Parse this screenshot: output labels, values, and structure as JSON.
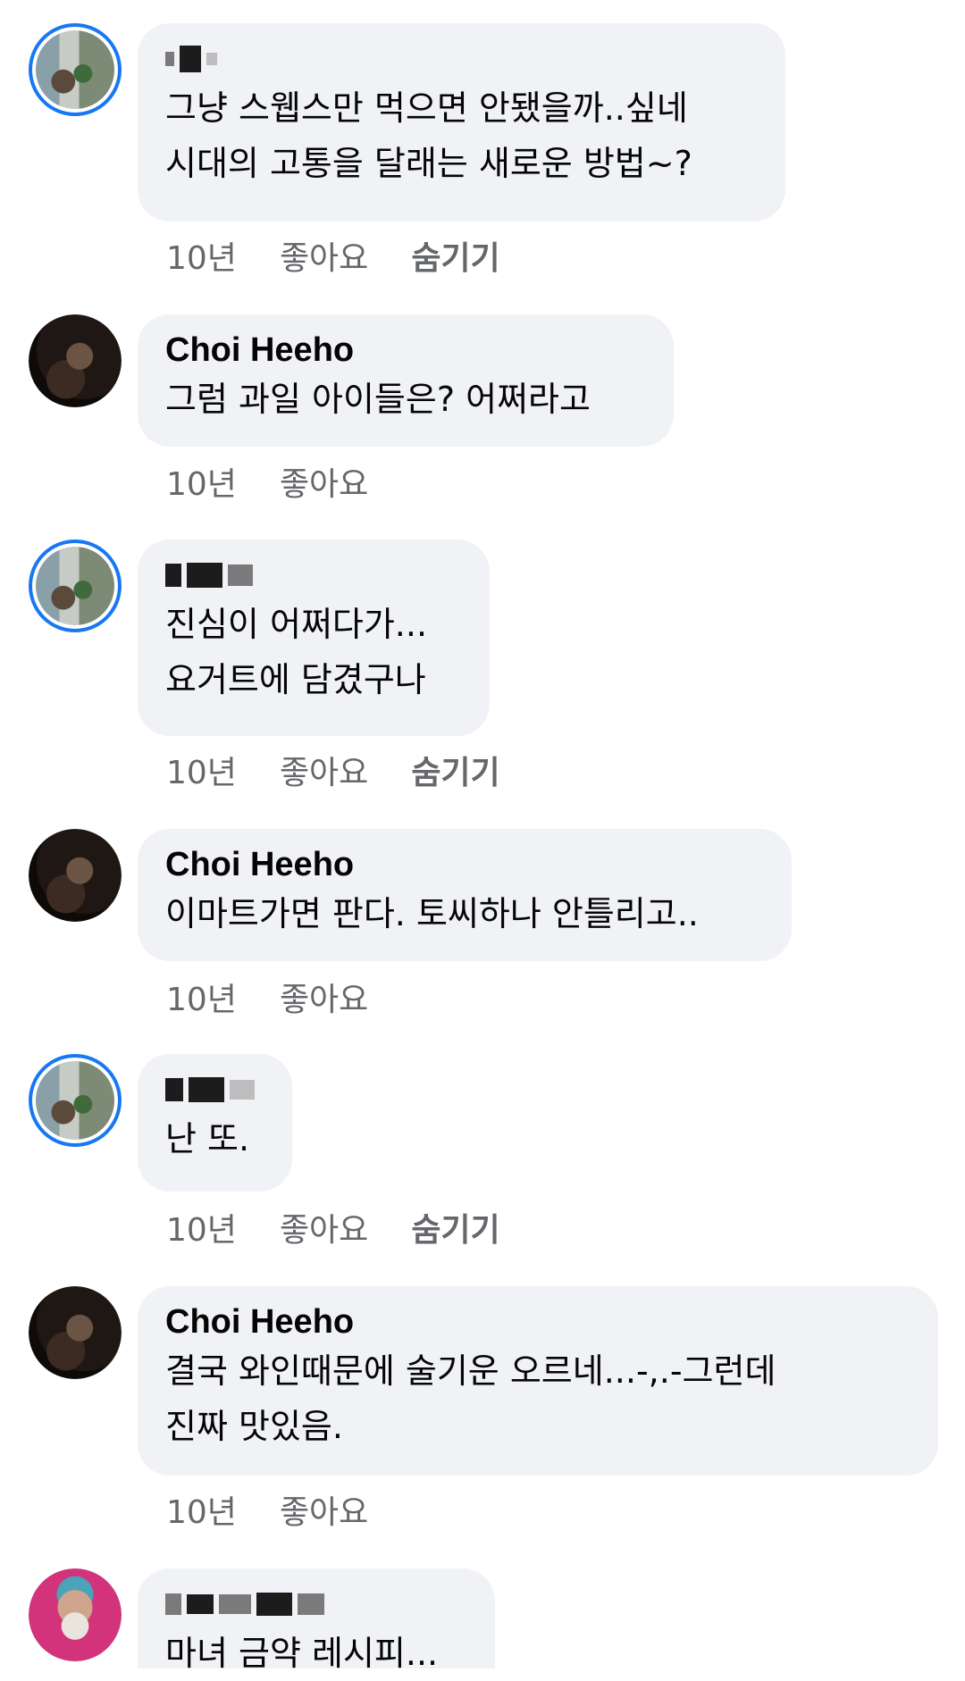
{
  "comments": [
    {
      "author": "",
      "author_hidden": true,
      "avatar": "avatar-room-photo",
      "text": "그냥 스웹스만 먹으면 안됐을까..싶네\n시대의 고통을 달래는 새로운 방법~?",
      "time": "10년",
      "like": "좋아요",
      "hide": "숨기기"
    },
    {
      "author": "Choi Heeho",
      "avatar": "avatar-dark-photo",
      "text": "그럼 과일 아이들은? 어쩌라고",
      "time": "10년",
      "like": "좋아요"
    },
    {
      "author": "",
      "author_hidden": true,
      "avatar": "avatar-room-photo",
      "text": "진심이 어쩌다가...\n요거트에 담겼구나",
      "time": "10년",
      "like": "좋아요",
      "hide": "숨기기"
    },
    {
      "author": "Choi Heeho",
      "avatar": "avatar-dark-photo",
      "text": "이마트가면 판다. 토씨하나 안틀리고..",
      "time": "10년",
      "like": "좋아요"
    },
    {
      "author": "",
      "author_hidden": true,
      "avatar": "avatar-room-photo",
      "text": "난 또.",
      "time": "10년",
      "like": "좋아요",
      "hide": "숨기기"
    },
    {
      "author": "Choi Heeho",
      "avatar": "avatar-dark-photo",
      "text": "결국 와인때문에 술기운 오르네...-,.-그런데\n진짜 맛있음.",
      "time": "10년",
      "like": "좋아요"
    },
    {
      "author": "",
      "author_hidden": true,
      "avatar": "avatar-pink-photo",
      "text": "마녀 금약 레시피..."
    }
  ],
  "colors": {
    "bubble": "#f0f2f5",
    "meta_text": "#65676b",
    "ring": "#1877f2"
  }
}
